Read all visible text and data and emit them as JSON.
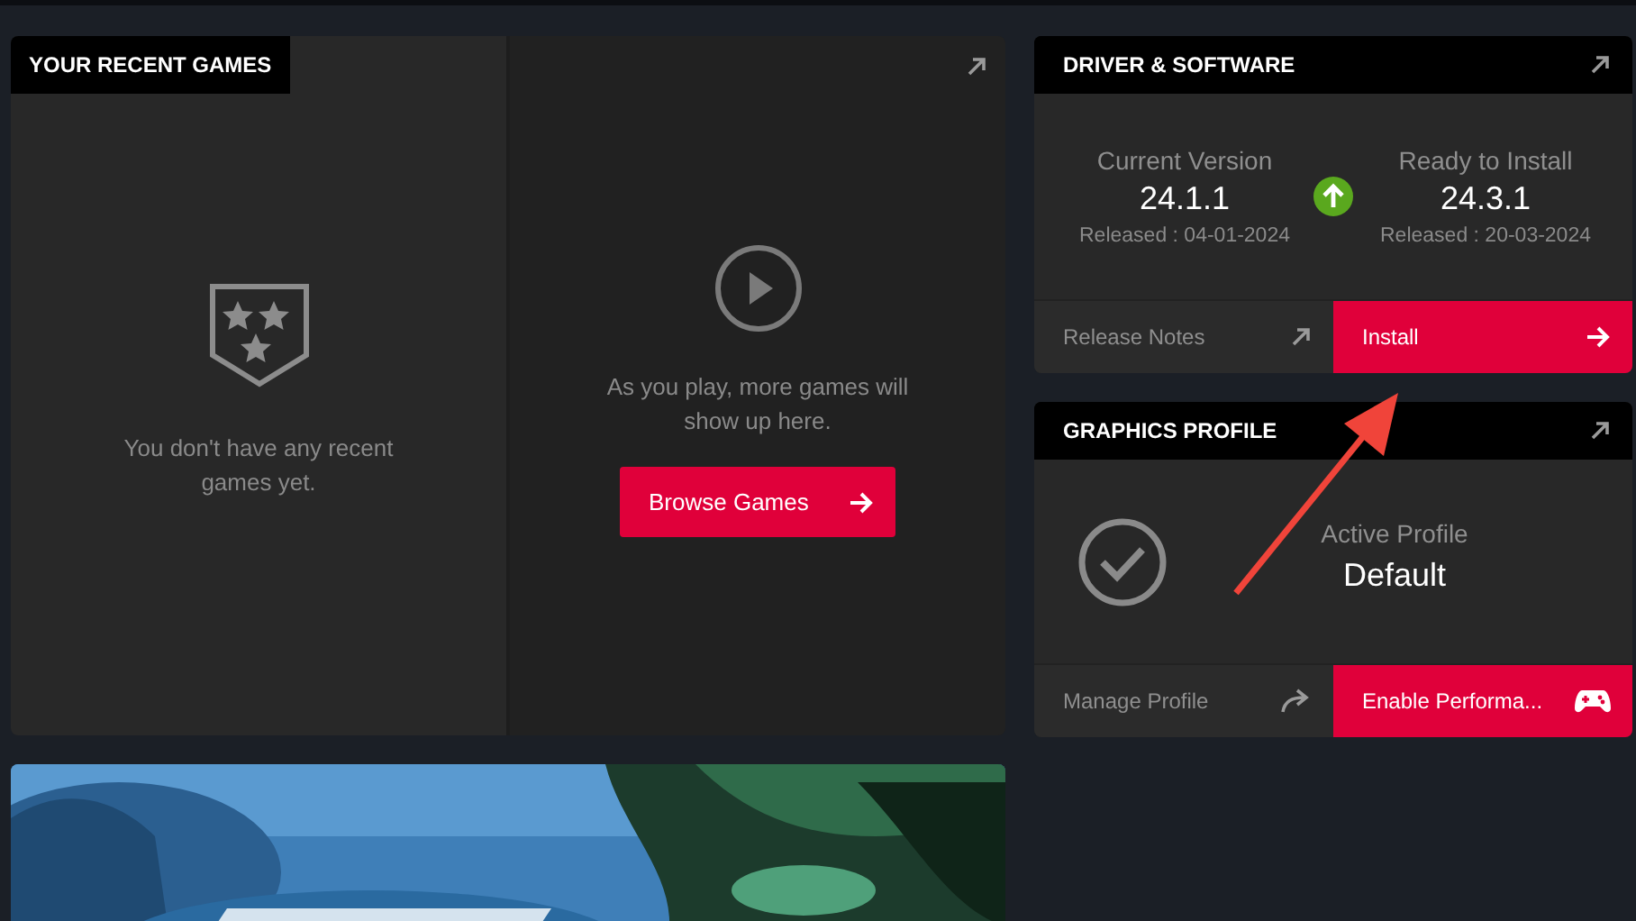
{
  "recent_games": {
    "title": "YOUR RECENT GAMES",
    "empty_message": "You don't have any recent games yet.",
    "play_message": "As you play, more games will show up here.",
    "browse_button": "Browse Games"
  },
  "driver_software": {
    "title": "DRIVER & SOFTWARE",
    "current": {
      "label": "Current Version",
      "version": "24.1.1",
      "released": "Released : 04-01-2024"
    },
    "available": {
      "label": "Ready to Install",
      "version": "24.3.1",
      "released": "Released : 20-03-2024"
    },
    "actions": [
      {
        "label": "Release Notes",
        "kind": "link"
      },
      {
        "label": "Install",
        "kind": "primary"
      }
    ]
  },
  "graphics_profile": {
    "title": "GRAPHICS PROFILE",
    "label": "Active Profile",
    "value": "Default",
    "actions": [
      {
        "label": "Manage Profile",
        "kind": "link"
      },
      {
        "label": "Enable Performa...",
        "kind": "primary"
      }
    ]
  }
}
